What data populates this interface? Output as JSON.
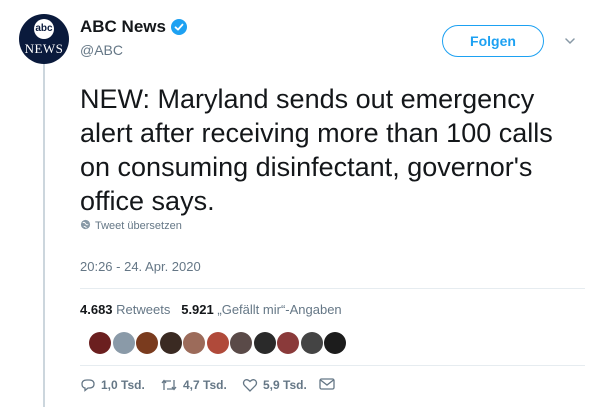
{
  "author": {
    "name": "ABC News",
    "handle": "@ABC",
    "avatar_top": "abc",
    "avatar_bottom": "NEWS"
  },
  "follow_label": "Folgen",
  "tweet": {
    "text": "NEW: Maryland sends out emergency alert after receiving more than 100 calls on consuming disinfectant, governor's office says.",
    "translate_label": "Tweet übersetzen",
    "timestamp": "20:26 - 24. Apr. 2020"
  },
  "stats": {
    "retweets_count": "4.683",
    "retweets_label": "Retweets",
    "likes_count": "5.921",
    "likes_label": "„Gefällt mir“-Angaben"
  },
  "liker_avatars": [
    "#6b1f1f",
    "#8a9aa8",
    "#7a3b1e",
    "#3a2a22",
    "#9c6b5a",
    "#b04a3a",
    "#5a4a48",
    "#2a2a2a",
    "#8a3a3a",
    "#444444",
    "#1c1c1c"
  ],
  "actions": {
    "replies": "1,0 Tsd.",
    "retweets": "4,7 Tsd.",
    "likes": "5,9 Tsd."
  },
  "colors": {
    "accent": "#1da1f2",
    "muted": "#657786",
    "avatar_bg": "#0a1a3c"
  }
}
